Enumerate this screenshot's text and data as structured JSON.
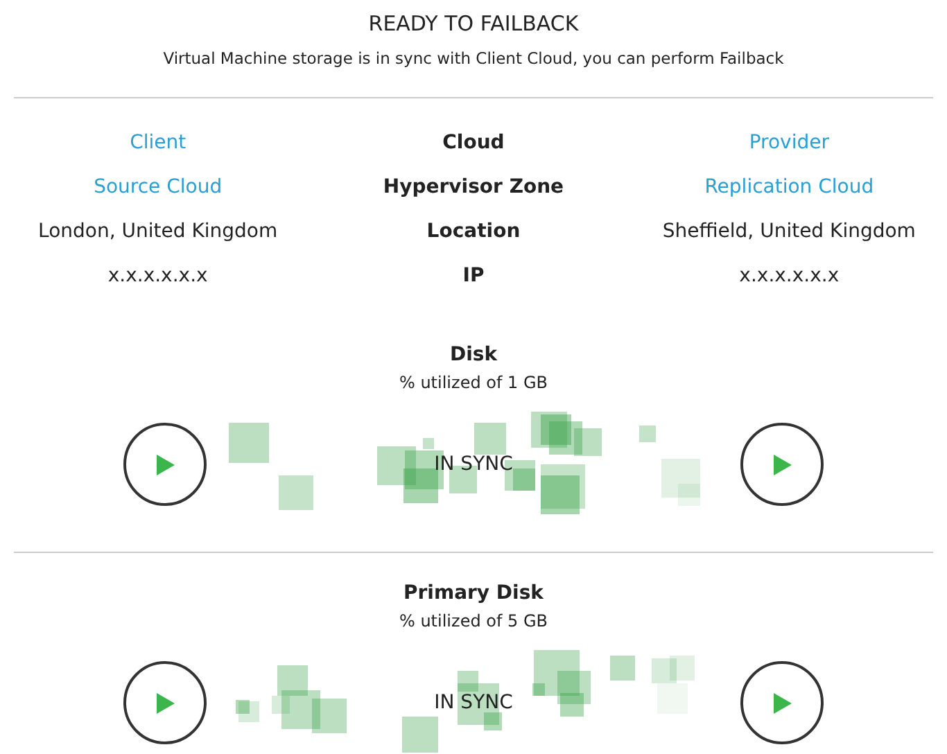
{
  "header": {
    "title": "READY TO FAILBACK",
    "subtitle": "Virtual Machine storage is in sync with Client Cloud, you can perform Failback"
  },
  "details": [
    {
      "kind": "heading",
      "left": "Client",
      "label": "Cloud",
      "right": "Provider"
    },
    {
      "kind": "heading",
      "left": "Source Cloud",
      "label": "Hypervisor Zone",
      "right": "Replication Cloud"
    },
    {
      "kind": "value",
      "left": "London, United Kingdom",
      "label": "Location",
      "right": "Sheffield, United Kingdom"
    },
    {
      "kind": "value",
      "left": "x.x.x.x.x.x",
      "label": "IP",
      "right": "x.x.x.x.x.x"
    }
  ],
  "disks": [
    {
      "name": "Disk",
      "usage": "% utilized of 1 GB",
      "status": "IN SYNC"
    },
    {
      "name": "Primary Disk",
      "usage": "% utilized of 5 GB",
      "status": "IN SYNC"
    }
  ]
}
